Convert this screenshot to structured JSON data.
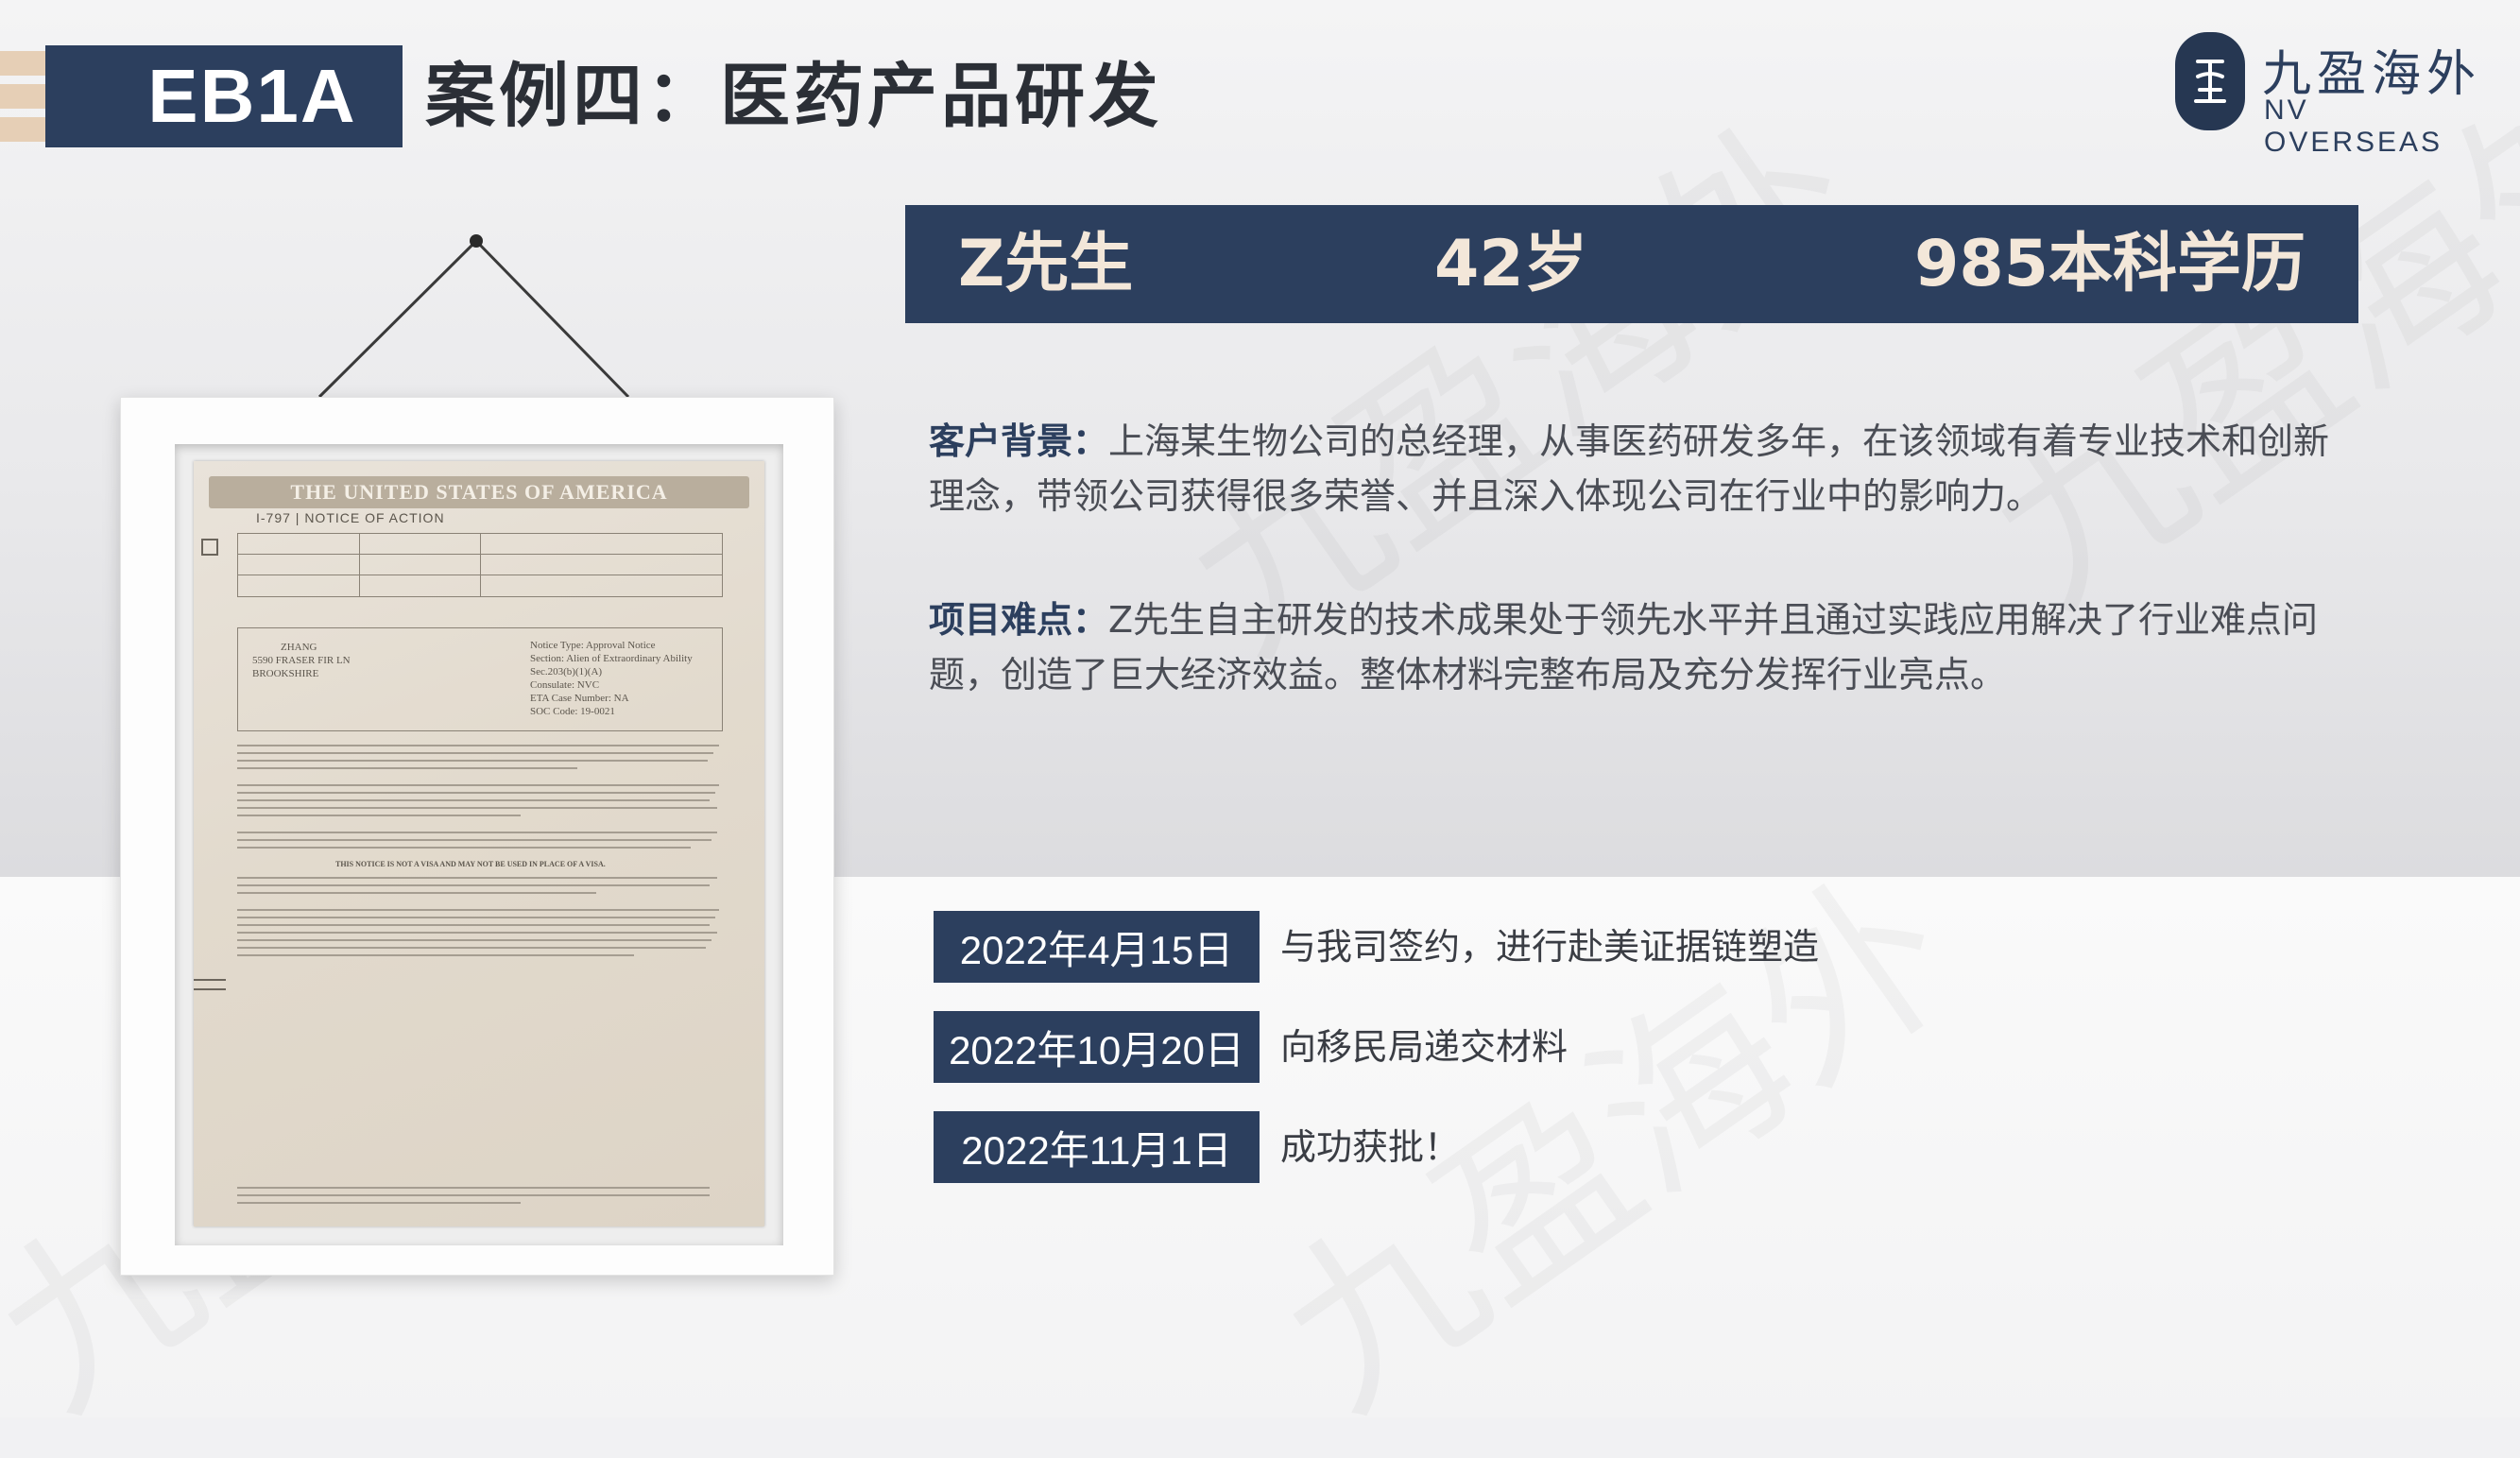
{
  "header": {
    "tag": "EB1A",
    "title": "案例四：医药产品研发"
  },
  "logo": {
    "name_cn": "九盈海外",
    "name_en": "NV OVERSEAS"
  },
  "banner": {
    "name": "Z先生",
    "age": "42岁",
    "education": "985本科学历"
  },
  "background": {
    "label": "客户背景：",
    "text": "上海某生物公司的总经理，从事医药研发多年，在该领域有着专业技术和创新理念，带领公司获得很多荣誉、并且深入体现公司在行业中的影响力。"
  },
  "difficulty": {
    "label": "项目难点：",
    "text": "Z先生自主研发的技术成果处于领先水平并且通过实践应用解决了行业难点问题，创造了巨大经济效益。整体材料完整布局及充分发挥行业亮点。"
  },
  "timeline": [
    {
      "date": "2022年4月15日",
      "text": "与我司签约，进行赴美证据链塑造"
    },
    {
      "date": "2022年10月20日",
      "text": "向移民局递交材料"
    },
    {
      "date": "2022年11月1日",
      "text": "成功获批！"
    }
  ],
  "document": {
    "heading": "THE UNITED STATES OF AMERICA",
    "subheading": "I-797 | NOTICE OF ACTION",
    "recipient": "ZHANG",
    "street": "5590 FRASER FIR LN",
    "city": "BROOKSHIRE",
    "notice_type": "Notice Type: Approval Notice",
    "section": "Section: Alien of Extraordinary Ability",
    "section_code": "Sec.203(b)(1)(A)",
    "consulate": "Consulate: NVC",
    "eta": "ETA Case Number: NA",
    "soc": "SOC Code: 19-0021",
    "notice_line": "THIS NOTICE IS NOT A VISA AND MAY NOT BE USED IN PLACE OF A VISA."
  },
  "colors": {
    "navy": "#2c3f5e",
    "beige": "#e6cfb6",
    "banner_text": "#f3e7d9"
  }
}
